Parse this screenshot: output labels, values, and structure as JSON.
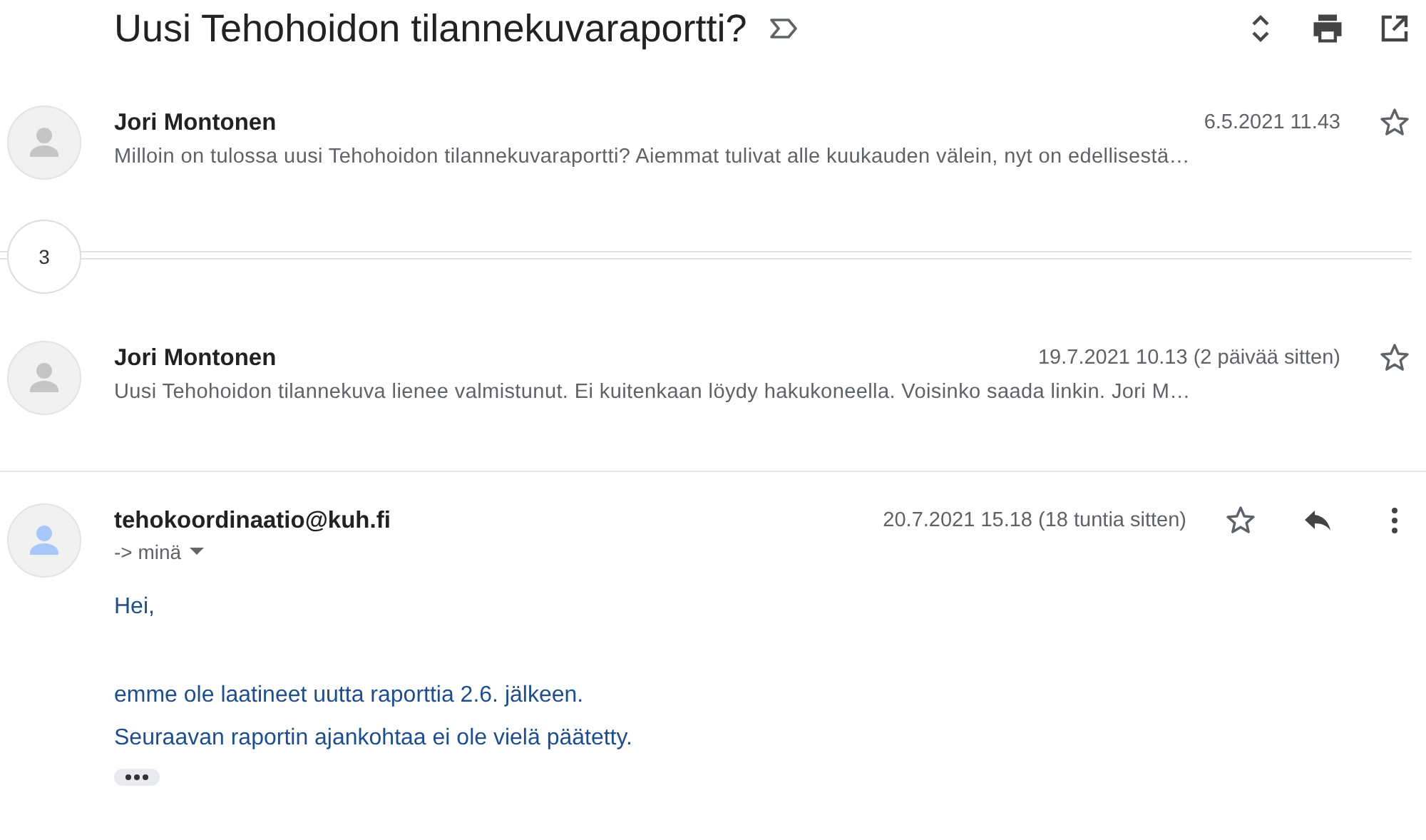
{
  "subject": "Uusi Tehohoidon tilannekuvaraportti?",
  "messages": [
    {
      "kind": "collapsed",
      "sender": "Jori Montonen",
      "date": "6.5.2021 11.43",
      "snippet": "Milloin on tulossa uusi Tehohoidon tilannekuvaraportti? Aiemmat tulivat alle kuukauden välein, nyt on edellisestä…",
      "color": "#c5c5c5"
    },
    {
      "kind": "hidden",
      "count": "3"
    },
    {
      "kind": "collapsed",
      "sender": "Jori Montonen",
      "date": "19.7.2021 10.13 (2 päivää sitten)",
      "snippet": "Uusi Tehohoidon tilannekuva lienee valmistunut. Ei kuitenkaan löydy hakukoneella. Voisinko saada linkin. Jori M…",
      "color": "#c5c5c5"
    },
    {
      "kind": "expanded",
      "sender": "tehokoordinaatio@kuh.fi",
      "date": "20.7.2021 15.18 (18 tuntia sitten)",
      "recipient": "-> minä",
      "color": "#a8c7fa",
      "body": [
        [
          "Hei,"
        ],
        [
          "emme ole laatineet uutta raporttia 2.6. jälkeen.",
          "Seuraavan raportin ajankohtaa ei ole vielä päätetty."
        ]
      ]
    }
  ]
}
